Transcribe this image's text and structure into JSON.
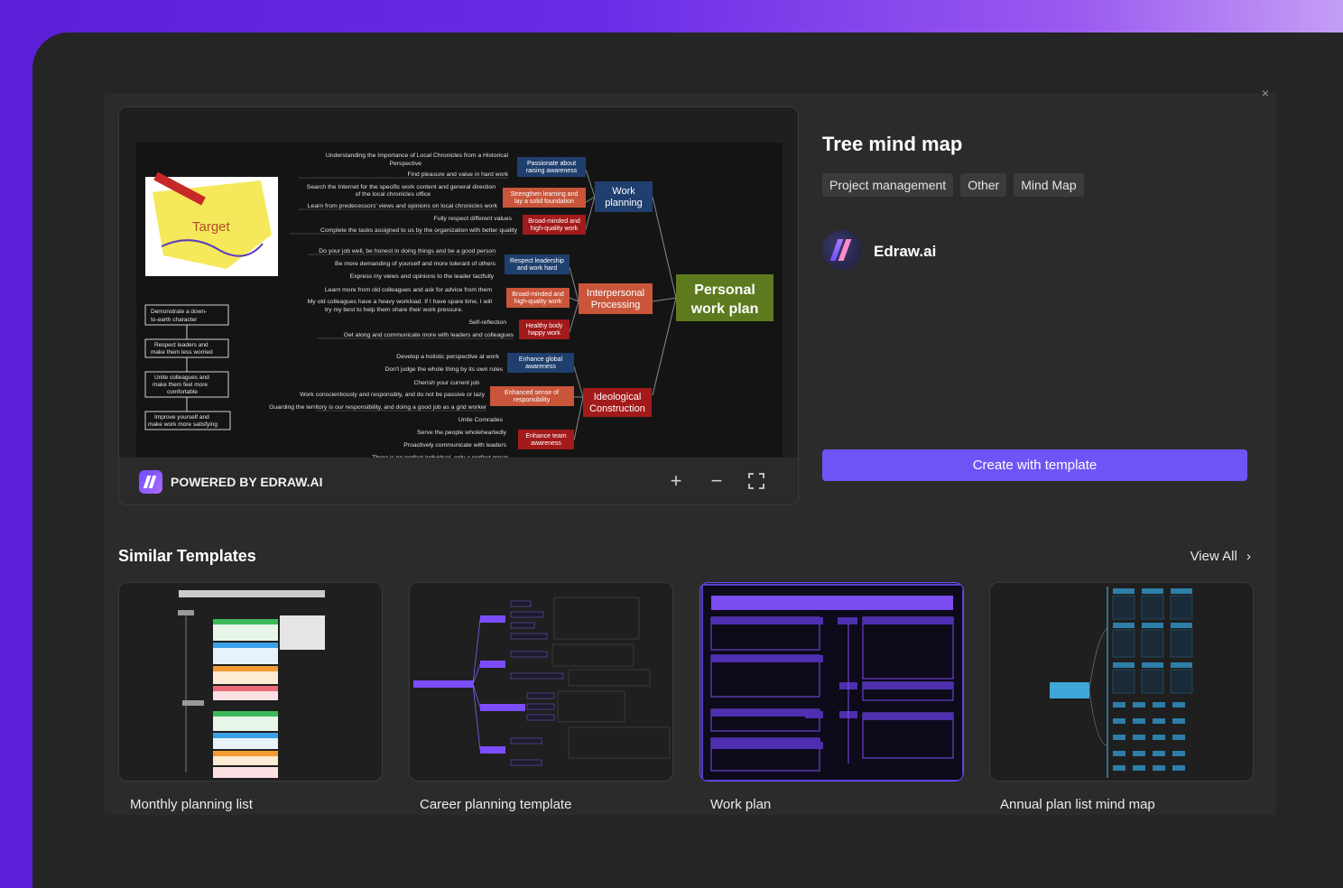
{
  "template": {
    "title": "Tree mind map",
    "tags": [
      "Project management",
      "Other",
      "Mind Map"
    ],
    "author": "Edraw.ai",
    "create_button": "Create with template",
    "close_icon": "x-icon"
  },
  "preview": {
    "powered_by": "POWERED BY EDRAW.AI",
    "zoom_in_icon": "plus-icon",
    "zoom_out_icon": "minus-icon",
    "fullscreen_icon": "expand-icon",
    "image_caption": "Target",
    "mindmap": {
      "root": "Personal work plan",
      "branches": [
        {
          "label": "Work planning",
          "children": [
            {
              "label": "Passionate about raising awareness",
              "color": "#1f3f6e",
              "notes": [
                "Understanding the Importance of Local Chronicles from a Historical Perspective",
                "Find pleasure and value in hard work"
              ]
            },
            {
              "label": "Strengthen learning and lay a solid foundation",
              "color": "#c9553a",
              "notes": [
                "Search the Internet for the specific work content and general direction of the local chronicles office",
                "Learn from predecessors' views and opinions on local chronicles work"
              ]
            },
            {
              "label": "Broad-minded and high-quality work",
              "color": "#a21a1a",
              "notes": [
                "Fully respect different values",
                "Complete the tasks assigned to us by the organization with better quality"
              ]
            }
          ]
        },
        {
          "label": "Interpersonal Processing",
          "children": [
            {
              "label": "Respect leadership and work hard",
              "color": "#1f3f6e",
              "notes": [
                "Do your job well, be honest in doing things and be a good person",
                "Be more demanding of yourself and more tolerant of others",
                "Express my views and opinions to the leader tactfully"
              ]
            },
            {
              "label": "Broad-minded and high-quality work",
              "color": "#c9553a",
              "notes": [
                "Learn more from old colleagues and ask for advice from them",
                "My old colleagues have a heavy workload. If I have spare time, I will try my best to help them share their work pressure."
              ]
            },
            {
              "label": "Healthy body happy work",
              "color": "#a21a1a",
              "notes": [
                "Self-reflection",
                "Get along and communicate more with leaders and colleagues"
              ]
            }
          ]
        },
        {
          "label": "Ideological Construction",
          "children": [
            {
              "label": "Enhance global awareness",
              "color": "#1f3f6e",
              "notes": [
                "Develop a holistic perspective at work",
                "Don't judge the whole thing by its own rules"
              ]
            },
            {
              "label": "Enhanced sense of responsibility",
              "color": "#c9553a",
              "notes": [
                "Cherish your current job",
                "Work conscientiously and responsibly, and do not be passive or lazy",
                "Guarding the territory is our responsibility, and doing a good job as a grid worker"
              ]
            },
            {
              "label": "Enhance team awareness",
              "color": "#a21a1a",
              "notes": [
                "Unite Comrades",
                "Serve the people wholeheartedly",
                "Proactively communicate with leaders",
                "There is no perfect individual, only a perfect group"
              ]
            }
          ]
        }
      ],
      "left_boxes": [
        "Demonstrate a down-to-earth character",
        "Respect leaders and make them less worried",
        "Unite colleagues and make them feel more comfortable",
        "Improve yourself and make work more satisfying"
      ]
    }
  },
  "similar": {
    "title": "Similar Templates",
    "view_all": "View All",
    "chevron_icon": "chevron-right-icon",
    "cards": [
      {
        "label": "Monthly planning list"
      },
      {
        "label": "Career planning template"
      },
      {
        "label": "Work plan"
      },
      {
        "label": "Annual plan list mind map"
      }
    ]
  }
}
